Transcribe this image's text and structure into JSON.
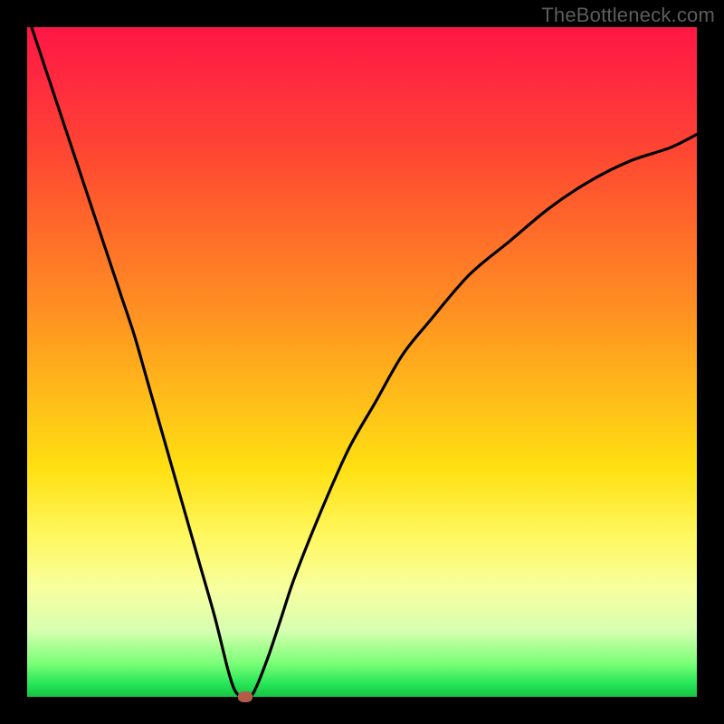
{
  "watermark": "TheBottleneck.com",
  "chart_data": {
    "type": "line",
    "title": "",
    "xlabel": "",
    "ylabel": "",
    "xlim": [
      0,
      100
    ],
    "ylim": [
      0,
      100
    ],
    "grid": false,
    "legend": false,
    "background_gradient": {
      "orientation": "vertical",
      "stops": [
        {
          "pos": 0.0,
          "color": "#ff1744"
        },
        {
          "pos": 0.3,
          "color": "#ff6a2a"
        },
        {
          "pos": 0.6,
          "color": "#ffe012"
        },
        {
          "pos": 0.85,
          "color": "#f7ffa0"
        },
        {
          "pos": 1.0,
          "color": "#17c443"
        }
      ]
    },
    "series": [
      {
        "name": "bottleneck-curve",
        "color": "#000000",
        "x": [
          0,
          2,
          4,
          6,
          8,
          10,
          12,
          14,
          16,
          18,
          20,
          22,
          24,
          26,
          28,
          30,
          31,
          32,
          33,
          34,
          36,
          38,
          40,
          44,
          48,
          52,
          56,
          60,
          66,
          72,
          78,
          84,
          90,
          96,
          100
        ],
        "y": [
          102,
          96,
          90,
          84,
          78,
          72,
          66,
          60,
          54,
          47,
          40,
          33,
          26,
          19,
          12,
          4,
          1,
          0,
          0,
          1,
          6,
          12,
          18,
          28,
          37,
          44,
          51,
          56,
          63,
          68,
          73,
          77,
          80,
          82,
          84
        ]
      }
    ],
    "marker": {
      "name": "optimal-point",
      "x": 32.5,
      "y": 0,
      "color": "#b65a4a"
    }
  }
}
